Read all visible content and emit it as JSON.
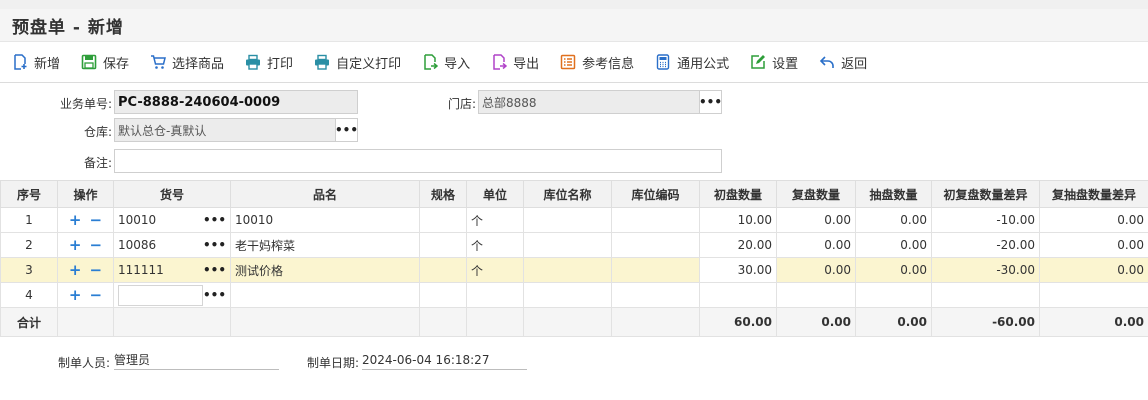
{
  "title": "预盘单 - 新增",
  "toolbar": [
    {
      "label": "新增",
      "icon": "add-doc-icon"
    },
    {
      "label": "保存",
      "icon": "save-icon"
    },
    {
      "label": "选择商品",
      "icon": "cart-icon"
    },
    {
      "label": "打印",
      "icon": "print-icon"
    },
    {
      "label": "自定义打印",
      "icon": "print-icon"
    },
    {
      "label": "导入",
      "icon": "import-icon"
    },
    {
      "label": "导出",
      "icon": "export-icon"
    },
    {
      "label": "参考信息",
      "icon": "list-icon"
    },
    {
      "label": "通用公式",
      "icon": "calculator-icon"
    },
    {
      "label": "设置",
      "icon": "edit-icon"
    },
    {
      "label": "返回",
      "icon": "back-icon"
    }
  ],
  "form": {
    "doc_no_label": "业务单号:",
    "doc_no": "PC-8888-240604-0009",
    "store_label": "门店:",
    "store": "总部8888",
    "warehouse_label": "仓库:",
    "warehouse": "默认总仓-真默认",
    "remark_label": "备注:",
    "remark": ""
  },
  "table": {
    "headers": [
      "序号",
      "操作",
      "货号",
      "品名",
      "规格",
      "单位",
      "库位名称",
      "库位编码",
      "初盘数量",
      "复盘数量",
      "抽盘数量",
      "初复盘数量差异",
      "复抽盘数量差异"
    ],
    "rows": [
      {
        "no": "1",
        "code": "10010",
        "name": "10010",
        "spec": "",
        "unit": "个",
        "loc_name": "",
        "loc_code": "",
        "q1": "10.00",
        "q2": "0.00",
        "q3": "0.00",
        "d1": "-10.00",
        "d2": "0.00"
      },
      {
        "no": "2",
        "code": "10086",
        "name": "老干妈榨菜",
        "spec": "",
        "unit": "个",
        "loc_name": "",
        "loc_code": "",
        "q1": "20.00",
        "q2": "0.00",
        "q3": "0.00",
        "d1": "-20.00",
        "d2": "0.00"
      },
      {
        "no": "3",
        "code": "111111",
        "name": "测试价格",
        "spec": "",
        "unit": "个",
        "loc_name": "",
        "loc_code": "",
        "q1": "30.00",
        "q2": "0.00",
        "q3": "0.00",
        "d1": "-30.00",
        "d2": "0.00"
      },
      {
        "no": "4",
        "code": "",
        "name": "",
        "spec": "",
        "unit": "",
        "loc_name": "",
        "loc_code": "",
        "q1": "",
        "q2": "",
        "q3": "",
        "d1": "",
        "d2": ""
      }
    ],
    "sum_label": "合计",
    "sum": {
      "q1": "60.00",
      "q2": "0.00",
      "q3": "0.00",
      "d1": "-60.00",
      "d2": "0.00"
    }
  },
  "footer": {
    "creator_label": "制单人员:",
    "creator": "管理员",
    "date_label": "制单日期:",
    "date": "2024-06-04 16:18:27"
  },
  "colors": {
    "accent": "#2a7ed3",
    "highlight_row": "#fbf5d0",
    "header_bg": "#f2f2f2"
  }
}
